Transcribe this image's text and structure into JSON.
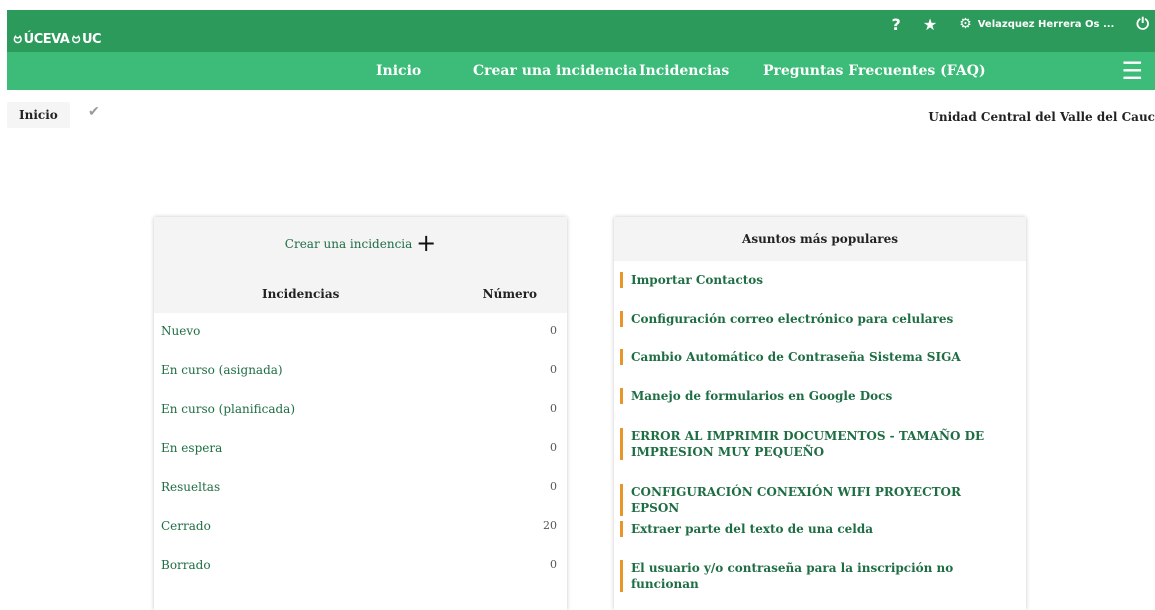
{
  "header": {
    "logo_left": "ÚCEVA",
    "logo_right": "UC",
    "help": "?",
    "user": "Velazquez Herrera Os ..."
  },
  "nav": {
    "items": [
      "Inicio",
      "Crear una incidencia",
      "Incidencias",
      "Preguntas Frecuentes (FAQ)"
    ]
  },
  "breadcrumb": {
    "label": "Inicio"
  },
  "entity": "Unidad Central del Valle del Cauc",
  "tickets": {
    "create": "Crear una incidencia",
    "col_status": "Incidencias",
    "col_number": "Número",
    "rows": [
      {
        "label": "Nuevo",
        "value": "0"
      },
      {
        "label": "En curso (asignada)",
        "value": "0"
      },
      {
        "label": "En curso (planificada)",
        "value": "0"
      },
      {
        "label": "En espera",
        "value": "0"
      },
      {
        "label": "Resueltas",
        "value": "0"
      },
      {
        "label": "Cerrado",
        "value": "20"
      },
      {
        "label": "Borrado",
        "value": "0"
      }
    ]
  },
  "popular": {
    "title": "Asuntos más populares",
    "items": [
      "Importar Contactos",
      "Configuración correo electrónico para celulares",
      "Cambio Automático de Contraseña Sistema SIGA",
      "Manejo de formularios en Google Docs",
      "ERROR AL IMPRIMIR DOCUMENTOS - TAMAÑO DE IMPRESION MUY PEQUEÑO",
      "CONFIGURACIÓN CONEXIÓN WIFI PROYECTOR EPSON",
      "Extraer parte del texto de una celda",
      "El usuario y/o contraseña para la inscripción no funcionan"
    ]
  }
}
